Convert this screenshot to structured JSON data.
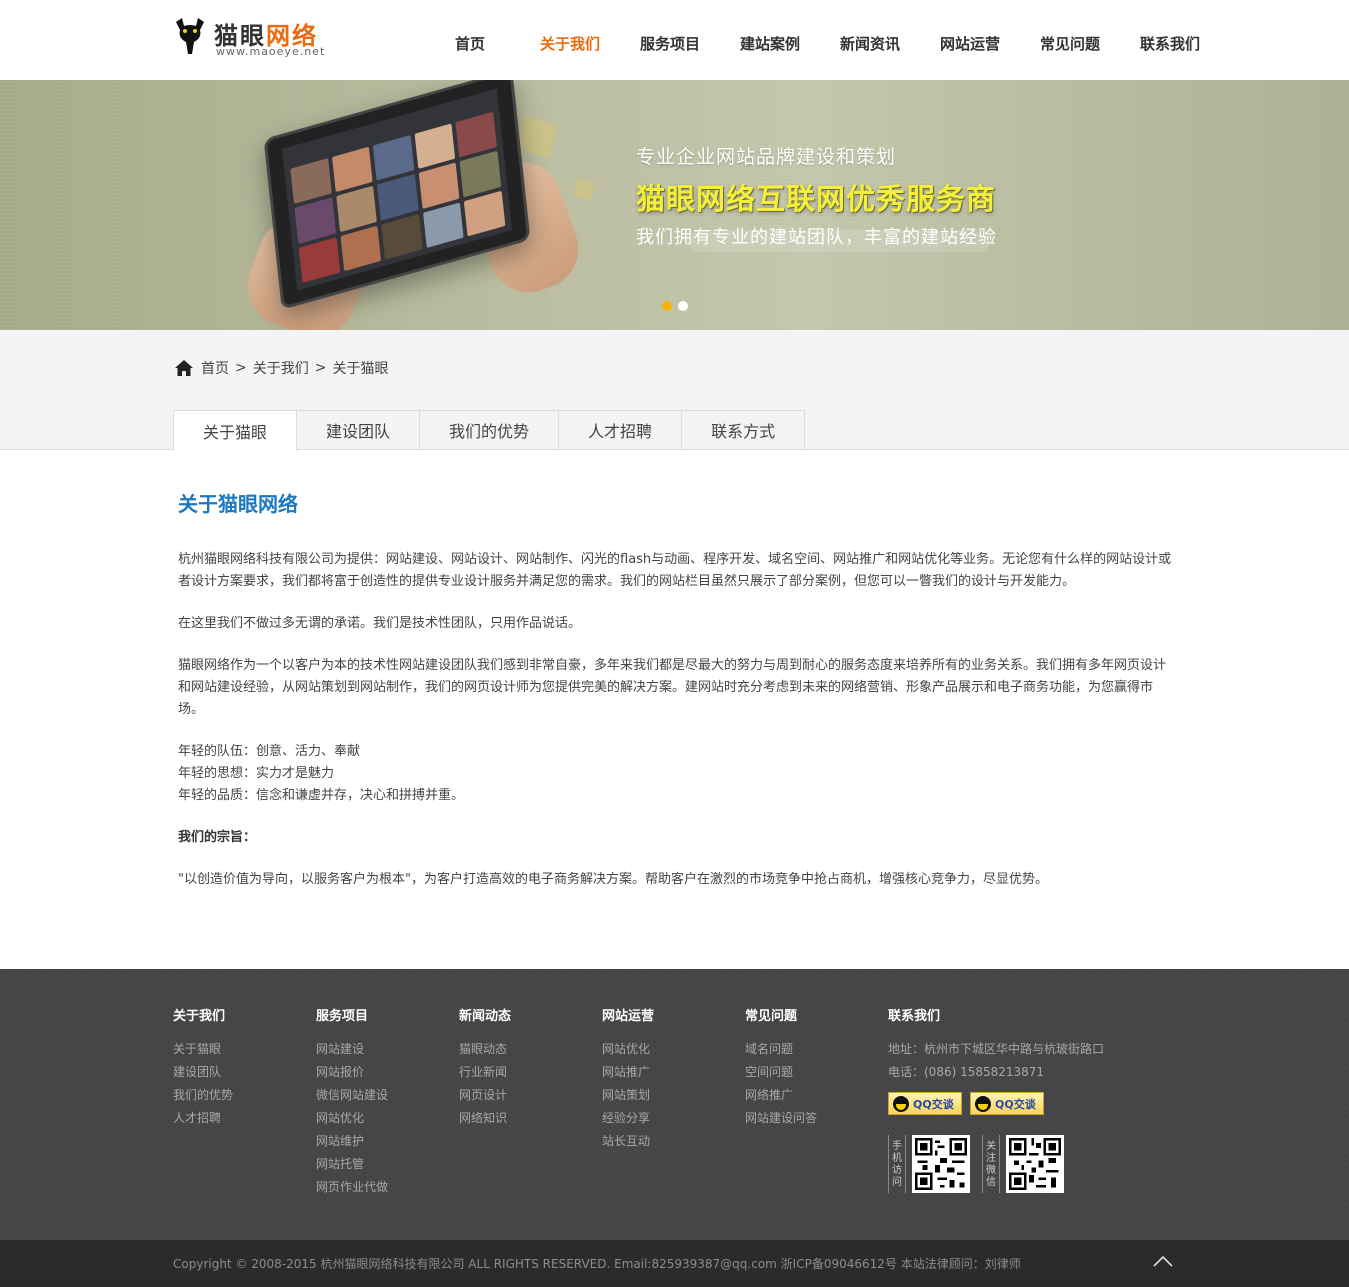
{
  "header": {
    "logo_text_main": "猫眼",
    "logo_text_accent": "网络",
    "logo_url": "www.maoeye.net",
    "nav": [
      {
        "label": "首页",
        "active": false
      },
      {
        "label": "关于我们",
        "active": true
      },
      {
        "label": "服务项目",
        "active": false
      },
      {
        "label": "建站案例",
        "active": false
      },
      {
        "label": "新闻资讯",
        "active": false
      },
      {
        "label": "网站运营",
        "active": false
      },
      {
        "label": "常见问题",
        "active": false
      },
      {
        "label": "联系我们",
        "active": false
      }
    ]
  },
  "banner": {
    "line1": "专业企业网站品牌建设和策划",
    "line2": "猫眼网络互联网优秀服务商",
    "line3": "我们拥有专业的建站团队，丰富的建站经验",
    "slide_count": 2,
    "active_slide": 1
  },
  "breadcrumb": {
    "items": [
      "首页",
      "关于我们",
      "关于猫眼"
    ],
    "separator": ">"
  },
  "tabs": [
    {
      "label": "关于猫眼",
      "active": true
    },
    {
      "label": "建设团队",
      "active": false
    },
    {
      "label": "我们的优势",
      "active": false
    },
    {
      "label": "人才招聘",
      "active": false
    },
    {
      "label": "联系方式",
      "active": false
    }
  ],
  "content": {
    "title": "关于猫眼网络",
    "p1": "杭州猫眼网络科技有限公司为提供：网站建设、网站设计、网站制作、闪光的flash与动画、程序开发、域名空间、网站推广和网站优化等业务。无论您有什么样的网站设计或者设计方案要求，我们都将富于创造性的提供专业设计服务并满足您的需求。我们的网站栏目虽然只展示了部分案例，但您可以一瞥我们的设计与开发能力。",
    "p2": "在这里我们不做过多无谓的承诺。我们是技术性团队，只用作品说话。",
    "p3": "猫眼网络作为一个以客户为本的技术性网站建设团队我们感到非常自豪，多年来我们都是尽最大的努力与周到耐心的服务态度来培养所有的业务关系。我们拥有多年网页设计和网站建设经验，从网站策划到网站制作，我们的网页设计师为您提供完美的解决方案。建网站时充分考虑到未来的网络营销、形象产品展示和电子商务功能，为您赢得市场。",
    "young1": "年轻的队伍：创意、活力、奉献",
    "young2": "年轻的思想：实力才是魅力",
    "young3": "年轻的品质：信念和谦虚并存，决心和拼搏并重。",
    "purpose_title": "我们的宗旨：",
    "purpose": "\"以创造价值为导向，以服务客户为根本\"，为客户打造高效的电子商务解决方案。帮助客户在激烈的市场竞争中抢占商机，增强核心竞争力，尽显优势。"
  },
  "footer": {
    "columns": [
      {
        "title": "关于我们",
        "items": [
          "关于猫眼",
          "建设团队",
          "我们的优势",
          "人才招聘"
        ]
      },
      {
        "title": "服务项目",
        "items": [
          "网站建设",
          "网站报价",
          "微信网站建设",
          "网站优化",
          "网站维护",
          "网站托管",
          "网页作业代做"
        ]
      },
      {
        "title": "新闻动态",
        "items": [
          "猫眼动态",
          "行业新闻",
          "网页设计",
          "网络知识"
        ]
      },
      {
        "title": "网站运营",
        "items": [
          "网站优化",
          "网站推广",
          "网站策划",
          "经验分享",
          "站长互动"
        ]
      },
      {
        "title": "常见问题",
        "items": [
          "域名问题",
          "空间问题",
          "网络推广",
          "网站建设问答"
        ]
      }
    ],
    "contact": {
      "title": "联系我们",
      "address": "地址：杭州市下城区华中路与杭玻街路口",
      "phone": "电话：(086) 15858213871",
      "qq1": "QQ交谈",
      "qq2": "QQ交谈",
      "qr1_label": [
        "手",
        "机",
        "访",
        "问"
      ],
      "qr2_label": [
        "关",
        "注",
        "微",
        "信"
      ]
    },
    "copyright": "Copyright  ©  2008-2015  杭州猫眼网络科技有限公司  ALL RIGHTS RESERVED.  Email:825939387@qq.com  浙ICP备09046612号  本站法律顾问：刘律师"
  },
  "colors": {
    "accent_orange": "#e96a11",
    "title_blue": "#1c78c0",
    "banner_yellow": "#f3ef3a",
    "footer_bg": "#444446",
    "copyright_bg": "#2b2b2b"
  }
}
